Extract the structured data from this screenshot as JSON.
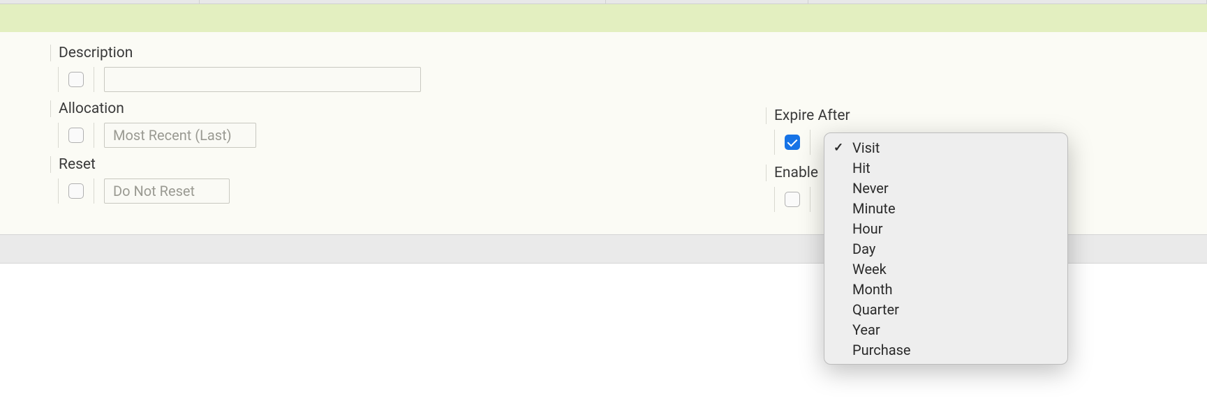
{
  "fields": {
    "description": {
      "label": "Description",
      "checked": false,
      "value": ""
    },
    "allocation": {
      "label": "Allocation",
      "checked": false,
      "value": "Most Recent (Last)"
    },
    "reset": {
      "label": "Reset",
      "checked": false,
      "value": "Do Not Reset"
    },
    "expire_after": {
      "label": "Expire After",
      "checked": true
    },
    "enable": {
      "label": "Enable",
      "checked": false
    }
  },
  "dropdown": {
    "selected": "Visit",
    "options": [
      "Visit",
      "Hit",
      "Never",
      "Minute",
      "Hour",
      "Day",
      "Week",
      "Month",
      "Quarter",
      "Year",
      "Purchase"
    ]
  }
}
